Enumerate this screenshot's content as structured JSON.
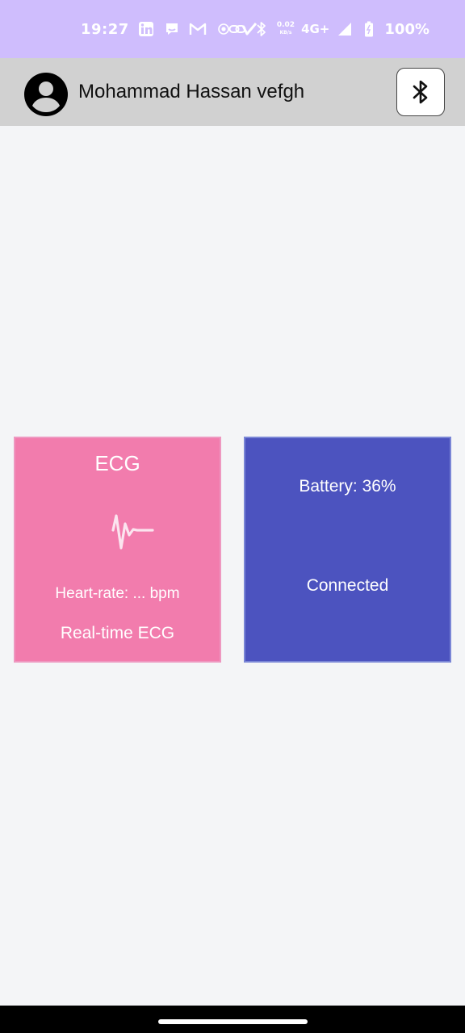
{
  "status_bar": {
    "time": "19:27",
    "net_speed_value": "0.02",
    "net_speed_unit": "KB/s",
    "network_type": "4G+",
    "battery_percent": "100%",
    "icons": [
      "linkedin-icon",
      "messenger-icon",
      "gmail-icon",
      "record-icon",
      "check-app-icon",
      "link-icon",
      "bluetooth-icon",
      "signal-icon",
      "battery-icon"
    ]
  },
  "app_bar": {
    "user_name": "Mohammad Hassan vefgh",
    "avatar_icon": "account-circle-icon",
    "bluetooth_button_icon": "bluetooth-icon"
  },
  "ecg_card": {
    "title": "ECG",
    "icon": "ecg-waveform-icon",
    "heart_rate": "Heart-rate: ... bpm",
    "action_label": "Real-time ECG",
    "background": "#f27cad"
  },
  "device_card": {
    "battery": "Battery: 36%",
    "status": "Connected",
    "background": "#4c53bf"
  },
  "colors": {
    "status_bar": "#cfbdfd",
    "app_bar": "#d1d1d1",
    "page_bg": "#f4f5f7"
  }
}
